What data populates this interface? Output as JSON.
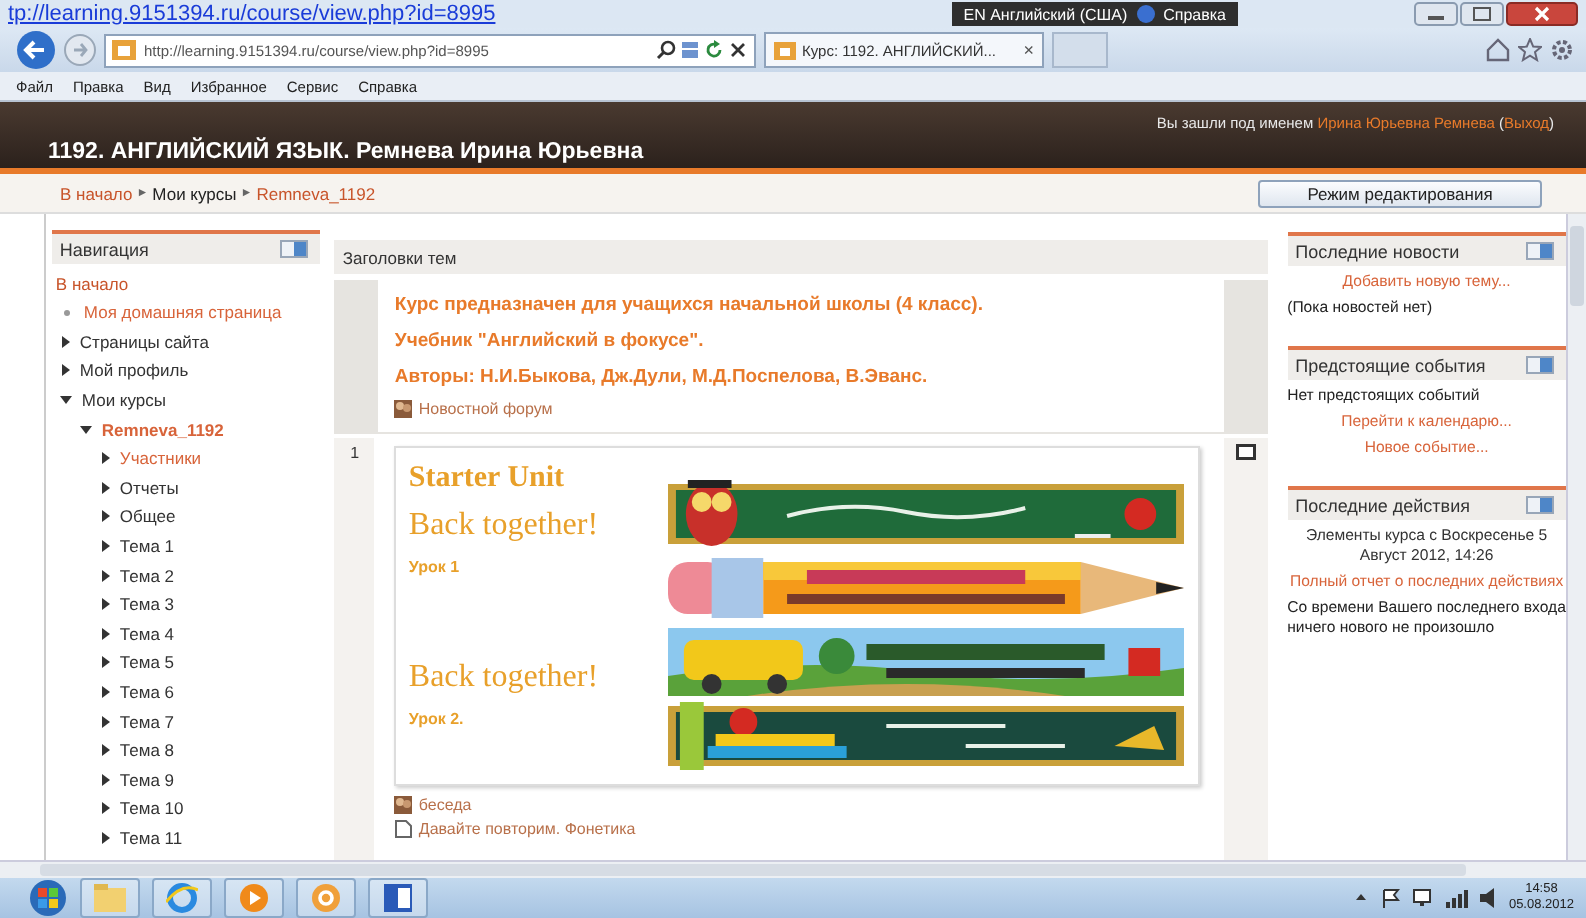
{
  "url_overlay": "tp://learning.9151394.ru/course/view.php?id=8995",
  "browser": {
    "address": "http://learning.9151394.ru/course/view.php?id=8995",
    "tab": {
      "title": "Курс: 1192. АНГЛИЙСКИЙ...",
      "close": "×"
    },
    "language": "EN Английский (США)",
    "help": "Справка",
    "menu": [
      "Файл",
      "Правка",
      "Вид",
      "Избранное",
      "Сервис",
      "Справка"
    ]
  },
  "header": {
    "title": "1192. АНГЛИЙСКИЙ ЯЗЫК. Ремнева Ирина Юрьевна",
    "login": [
      {
        "kind": "text",
        "text": "Вы зашли под именем "
      },
      {
        "kind": "link",
        "text": "Ирина Юрьевна Ремнева"
      },
      {
        "kind": "text",
        "text": " ("
      },
      {
        "kind": "link",
        "text": "Выход"
      },
      {
        "kind": "text",
        "text": ")"
      }
    ]
  },
  "breadcrumb": {
    "separator": "►",
    "items": [
      {
        "label": "В начало",
        "link": true
      },
      {
        "label": "Мои курсы",
        "link": false
      },
      {
        "label": "Remneva_1192",
        "link": true
      }
    ]
  },
  "edit_button": "Режим редактирования",
  "nav": {
    "title": "Навигация",
    "home": "В начало",
    "items": [
      {
        "label": "Моя домашняя страница",
        "kind": "leaf",
        "link": true,
        "current": false
      },
      {
        "label": "Страницы сайта",
        "kind": "branch",
        "expanded": false,
        "link": false,
        "current": false
      },
      {
        "label": "Мой профиль",
        "kind": "branch",
        "expanded": false,
        "link": false,
        "current": false
      },
      {
        "label": "Мои курсы",
        "kind": "branch",
        "expanded": true,
        "link": false,
        "current": false,
        "children": [
          {
            "label": "Remneva_1192",
            "kind": "branch",
            "expanded": true,
            "link": true,
            "current": true,
            "children": [
              {
                "label": "Участники",
                "kind": "branch",
                "expanded": false,
                "link": true,
                "current": false
              },
              {
                "label": "Отчеты",
                "kind": "branch",
                "expanded": false,
                "link": false,
                "current": false
              },
              {
                "label": "Общее",
                "kind": "branch",
                "expanded": false,
                "link": false,
                "current": false
              },
              {
                "label": "Тема 1",
                "kind": "branch",
                "expanded": false,
                "link": false,
                "current": false
              },
              {
                "label": "Тема 2",
                "kind": "branch",
                "expanded": false,
                "link": false,
                "current": false
              },
              {
                "label": "Тема 3",
                "kind": "branch",
                "expanded": false,
                "link": false,
                "current": false
              },
              {
                "label": "Тема 4",
                "kind": "branch",
                "expanded": false,
                "link": false,
                "current": false
              },
              {
                "label": "Тема 5",
                "kind": "branch",
                "expanded": false,
                "link": false,
                "current": false
              },
              {
                "label": "Тема 6",
                "kind": "branch",
                "expanded": false,
                "link": false,
                "current": false
              },
              {
                "label": "Тема 7",
                "kind": "branch",
                "expanded": false,
                "link": false,
                "current": false
              },
              {
                "label": "Тема 8",
                "kind": "branch",
                "expanded": false,
                "link": false,
                "current": false
              },
              {
                "label": "Тема 9",
                "kind": "branch",
                "expanded": false,
                "link": false,
                "current": false
              },
              {
                "label": "Тема 10",
                "kind": "branch",
                "expanded": false,
                "link": false,
                "current": false
              },
              {
                "label": "Тема 11",
                "kind": "branch",
                "expanded": false,
                "link": false,
                "current": false
              }
            ]
          }
        ]
      }
    ]
  },
  "center": {
    "heading": "Заголовки тем",
    "intro": {
      "lines": [
        "Курс предназначен для учащихся начальной школы (4 класс).",
        "Учебник \"Английский в фокусе\".",
        "Авторы: Н.И.Быкова, Дж.Дули, М.Д.Поспелова, В.Эванс."
      ],
      "items": [
        {
          "kind": "forum",
          "label": "Новостной форум"
        }
      ]
    },
    "section": {
      "number": "1",
      "texts": [
        {
          "kind": "unit",
          "text": "Starter Unit"
        },
        {
          "kind": "title",
          "text": "Back together!"
        },
        {
          "kind": "lesson",
          "text": "Урок 1"
        },
        {
          "kind": "title",
          "text": "Back together!"
        },
        {
          "kind": "lesson",
          "text": "Урок 2."
        }
      ],
      "items": [
        {
          "kind": "forum",
          "label": "беседа"
        },
        {
          "kind": "page",
          "label": "Давайте повторим. Фонетика"
        }
      ]
    }
  },
  "blocks": [
    {
      "title": "Последние новости",
      "lines": [
        {
          "kind": "link",
          "text": "Добавить новую тему..."
        },
        {
          "kind": "text",
          "text": "(Пока новостей нет)"
        }
      ]
    },
    {
      "title": "Предстоящие события",
      "lines": [
        {
          "kind": "text",
          "text": "Нет предстоящих событий"
        },
        {
          "kind": "link",
          "text": "Перейти к календарю..."
        },
        {
          "kind": "link",
          "text": "Новое событие..."
        }
      ]
    },
    {
      "title": "Последние действия",
      "lines": [
        {
          "kind": "note",
          "text": "Элементы курса с Воскресенье 5 Август 2012, 14:26"
        },
        {
          "kind": "link",
          "text": "Полный отчет о последних действиях"
        },
        {
          "kind": "text",
          "text": "Со времени Вашего последнего входа ничего нового не произошло"
        }
      ]
    }
  ],
  "taskbar": {
    "time": "14:58",
    "date": "05.08.2012"
  }
}
